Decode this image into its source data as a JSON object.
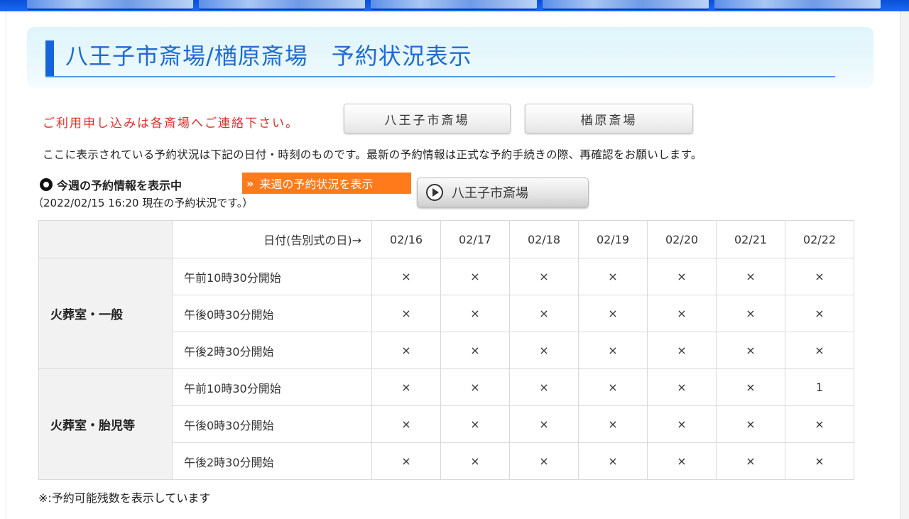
{
  "title": "八王子市斎場/楢原斎場　予約状況表示",
  "notice": "ご利用申し込みは各斎場へご連絡下さい。",
  "buttons": {
    "hachioji": "八王子市斎場",
    "narahara": "楢原斎場"
  },
  "info_text": "ここに表示されている予約状況は下記の日付・時刻のものです。最新の予約情報は正式な予約手続きの際、再確認をお願いします。",
  "week_label": "今週の予約情報を表示中",
  "next_week_link": "来週の予約状況を表示",
  "facility_button": "八王子市斎場",
  "as_of": "（2022/02/15 16:20 現在の予約状況です。）",
  "table": {
    "header_label": "日付(告別式の日)→",
    "dates": [
      "02/16",
      "02/17",
      "02/18",
      "02/19",
      "02/20",
      "02/21",
      "02/22"
    ],
    "groups": [
      {
        "category": "火葬室・一般",
        "rows": [
          {
            "slot": "午前10時30分開始",
            "values": [
              "×",
              "×",
              "×",
              "×",
              "×",
              "×",
              "×"
            ]
          },
          {
            "slot": "午後0時30分開始",
            "values": [
              "×",
              "×",
              "×",
              "×",
              "×",
              "×",
              "×"
            ]
          },
          {
            "slot": "午後2時30分開始",
            "values": [
              "×",
              "×",
              "×",
              "×",
              "×",
              "×",
              "×"
            ]
          }
        ]
      },
      {
        "category": "火葬室・胎児等",
        "rows": [
          {
            "slot": "午前10時30分開始",
            "values": [
              "×",
              "×",
              "×",
              "×",
              "×",
              "×",
              "1"
            ]
          },
          {
            "slot": "午後0時30分開始",
            "values": [
              "×",
              "×",
              "×",
              "×",
              "×",
              "×",
              "×"
            ]
          },
          {
            "slot": "午後2時30分開始",
            "values": [
              "×",
              "×",
              "×",
              "×",
              "×",
              "×",
              "×"
            ]
          }
        ]
      }
    ]
  },
  "footnote": "※:予約可能残数を表示しています"
}
